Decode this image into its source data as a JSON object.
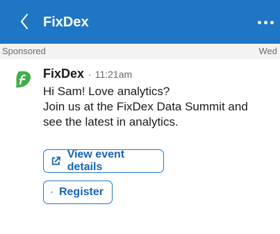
{
  "header": {
    "title": "FixDex",
    "back_icon": "chevron-left-icon",
    "more_icon": "more-horizontal-icon",
    "background": "#1f76c4"
  },
  "subbar": {
    "sponsored_label": "Sponsored",
    "day": "Wed"
  },
  "message": {
    "avatar_icon": "fixdex-logo-icon",
    "sender": "FixDex",
    "separator": "·",
    "time": "11:21am",
    "lines": [
      "Hi Sam! Love analytics?",
      "Join us at the FixDex Data Summit and",
      "see the latest in analytics."
    ]
  },
  "actions": {
    "view_details_label": "View event details",
    "register_label": "Register",
    "link_icon": "external-link-icon",
    "accent": "#1f76c4"
  }
}
